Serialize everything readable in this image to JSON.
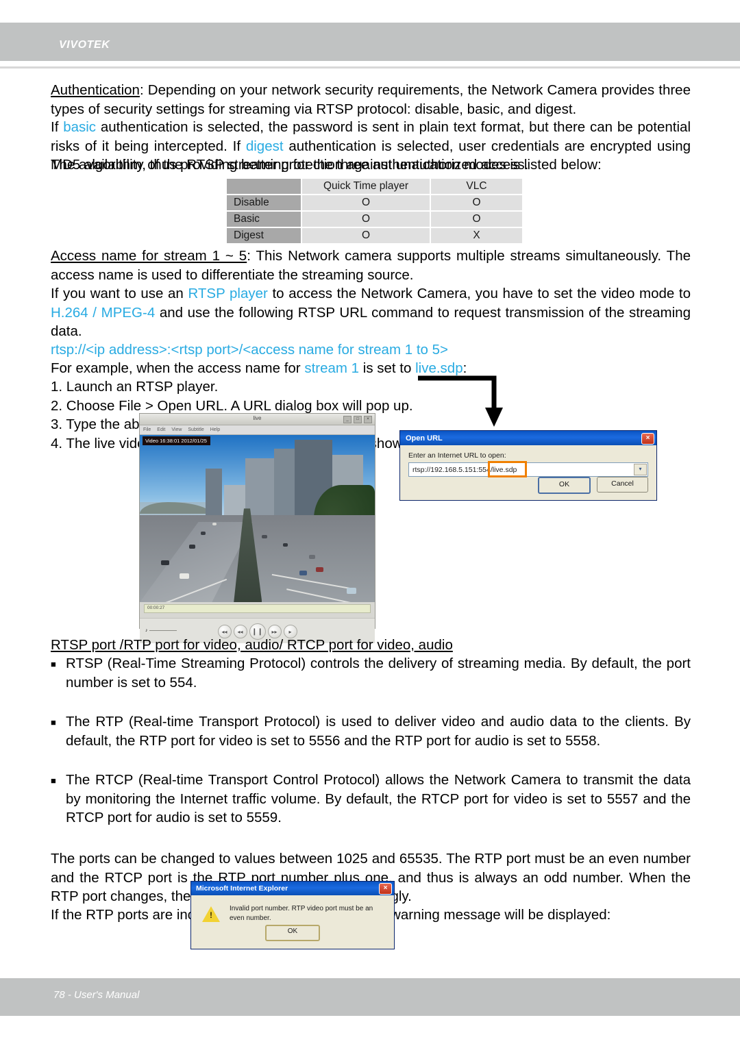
{
  "header": {
    "brand": "VIVOTEK"
  },
  "footer": {
    "text": "78 - User's Manual"
  },
  "body": {
    "auth_para_1_a": "Authentication",
    "auth_para_1_b": ": Depending on your network security requirements, the Network Camera provides three types of security settings for streaming via RTSP protocol: disable, basic, and digest.",
    "auth_para_2_a": "If ",
    "auth_para_2_basic": "basic",
    "auth_para_2_b": " authentication is selected, the password is sent in plain text format, but there can be potential risks of it being intercepted. If ",
    "auth_para_2_digest": "digest",
    "auth_para_2_c": " authentication is selected, user credentials are encrypted using MD5 algorithm, thus providing better protection against unauthorized access.",
    "auth_para_3": "The availability of the RTSP streaming for the three authentication modes is listed below:",
    "access_para_a": "Access name for stream 1 ~ 5",
    "access_para_b": ": This Network camera supports multiple streams simultaneously. The access name is used to differentiate the streaming source.",
    "rtsp_para_a": "If you want to use an ",
    "rtsp_player_link": "RTSP player",
    "rtsp_para_b": " to access the Network Camera, you have to set the video mode to ",
    "rtsp_codec_link": "H.264 / MPEG-4",
    "rtsp_para_c": " and use the following RTSP URL command to request transmission of the streaming data.",
    "rtsp_url_template": "rtsp://<ip address>:<rtsp port>/<access name for stream 1 to 5>",
    "example_a": "For example, when the access name for ",
    "example_stream": "stream 1",
    "example_b": " is set to ",
    "example_sdp": "live.sdp",
    "example_c": ":",
    "steps": [
      "1. Launch an RTSP player.",
      "2. Choose File > Open URL. A URL dialog box will pop up.",
      "3. Type the above URL command in the text box.",
      "4. The live video will be displayed in your player as shown below."
    ],
    "ports_heading": "RTSP port /RTP port for video, audio/ RTCP port for video, audio",
    "bullets": [
      "RTSP (Real-Time Streaming Protocol) controls the delivery of streaming media. By default, the port number is set to 554.",
      "The RTP (Real-time Transport Protocol) is used to deliver video and audio data to the clients. By default, the RTP port for video is set to 5556 and the RTP port for audio is set to 5558.",
      "The RTCP (Real-time Transport Control Protocol) allows the Network Camera to transmit the data by monitoring the Internet traffic volume. By default, the RTCP port for video is set to 5557 and the RTCP port for audio is set to 5559."
    ],
    "ports_range_para": "The ports can be changed to values between 1025 and 65535. The RTP port must be an even number and the RTCP port is the RTP port number plus one, and thus is always an odd number. When the RTP port changes, the RTCP port will change accordingly.",
    "warning_intro": "If the RTP ports are incorrectly assigned, the following warning message will be displayed:"
  },
  "auth_table": {
    "corner": "",
    "columns": [
      "Quick Time player",
      "VLC"
    ],
    "rows": [
      {
        "label": "Disable",
        "quicktime": "O",
        "vlc": "O"
      },
      {
        "label": "Basic",
        "quicktime": "O",
        "vlc": "O"
      },
      {
        "label": "Digest",
        "quicktime": "O",
        "vlc": "X"
      }
    ]
  },
  "player": {
    "window_title": "live",
    "minimize": "_",
    "maximize": "□",
    "close": "×",
    "menu": [
      "File",
      "Edit",
      "View",
      "Subtitle",
      "Help"
    ],
    "osd_text": "Video 16:38:01 2012/01/25",
    "seek_time": "00:00:27",
    "controls": [
      "◂◂",
      "◂◂",
      "❙❙",
      "▸▸",
      "▸"
    ],
    "volume_icon": "🔊"
  },
  "open_url_dialog": {
    "title": "Open URL",
    "close_label": "×",
    "prompt": "Enter an Internet URL to open:",
    "url_prefix": "rtsp://192.168.5.151:554/",
    "url_highlight": "live.sdp",
    "combo_arrow": "▾",
    "ok_label": "OK",
    "cancel_label": "Cancel",
    "highlight_color": "#f08000"
  },
  "ie_warning_dialog": {
    "title": "Microsoft Internet Explorer",
    "close_label": "×",
    "warning_symbol": "!",
    "message": "Invalid port number. RTP video port must be an even number.",
    "ok_label": "OK"
  },
  "colors": {
    "brand_bar": "#c0c2c2",
    "link_blue": "#29abe2",
    "table_header": "#a8a8a8",
    "table_cell": "#e0e0e0"
  }
}
